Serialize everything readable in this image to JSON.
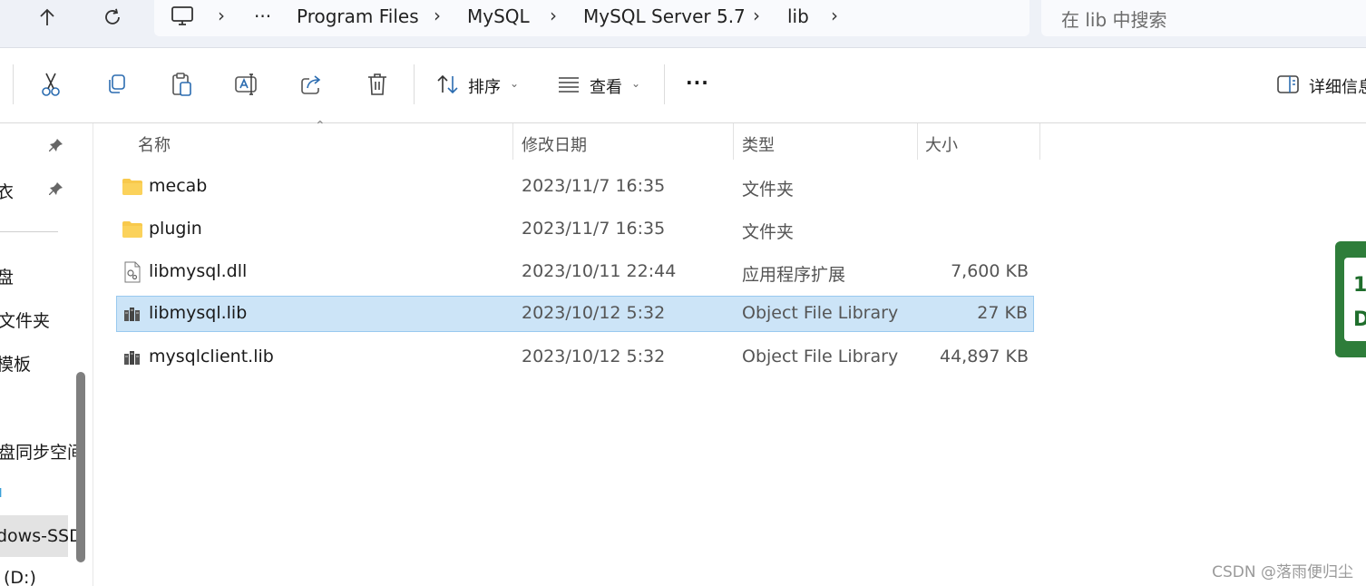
{
  "address_bar": {
    "segments": [
      "Program Files",
      "MySQL",
      "MySQL Server 5.7",
      "lib"
    ],
    "ellipsis": "···"
  },
  "search": {
    "placeholder": "在 lib 中搜索"
  },
  "toolbar": {
    "sort_label": "排序",
    "view_label": "查看",
    "more_label": "···",
    "details_label": "详细信息"
  },
  "nav_pane": {
    "items": [
      "衣",
      "盘",
      "文件夹",
      "模板",
      "盘同步空间",
      "dows-SSD",
      "(D:)"
    ]
  },
  "columns": {
    "name": "名称",
    "date": "修改日期",
    "type": "类型",
    "size": "大小"
  },
  "files": [
    {
      "name": "mecab",
      "date": "2023/11/7 16:35",
      "type": "文件夹",
      "size": "",
      "icon": "folder-icon"
    },
    {
      "name": "plugin",
      "date": "2023/11/7 16:35",
      "type": "文件夹",
      "size": "",
      "icon": "folder-icon"
    },
    {
      "name": "libmysql.dll",
      "date": "2023/10/11 22:44",
      "type": "应用程序扩展",
      "size": "7,600 KB",
      "icon": "dll-file-icon"
    },
    {
      "name": "libmysql.lib",
      "date": "2023/10/12 5:32",
      "type": "Object File Library",
      "size": "27 KB",
      "icon": "lib-file-icon",
      "selected": true
    },
    {
      "name": "mysqlclient.lib",
      "date": "2023/10/12 5:32",
      "type": "Object File Library",
      "size": "44,897 KB",
      "icon": "lib-file-icon"
    }
  ],
  "decor": {
    "card_top": "1",
    "card_bottom": "D"
  },
  "watermark": "CSDN @落雨便归尘",
  "colors": {
    "selection_bg": "#cce4f7",
    "selection_border": "#99c9ef",
    "folder_yellow": "#f8c94c"
  }
}
